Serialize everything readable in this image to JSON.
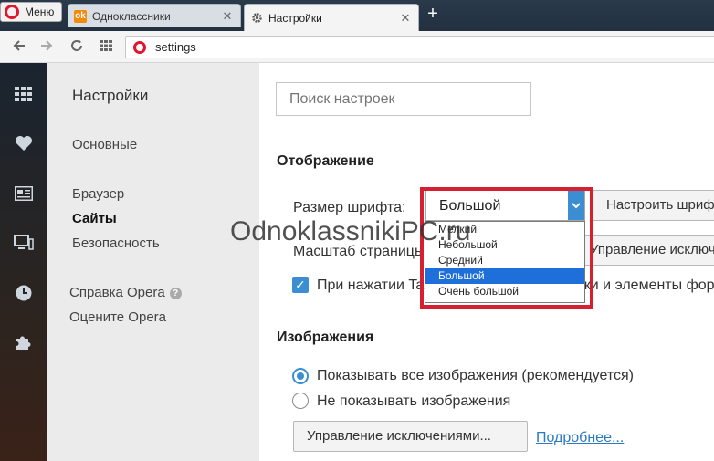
{
  "browser": {
    "menu_label": "Меню",
    "tabs": [
      {
        "title": "Одноклассники",
        "icon": "odnoklassniki-icon"
      },
      {
        "title": "Настройки",
        "icon": "gear-icon"
      }
    ],
    "new_tab_symbol": "+",
    "close_symbol": "✕",
    "address": "settings"
  },
  "nav": {
    "title": "Настройки",
    "items": [
      "Основные",
      "Браузер",
      "Сайты",
      "Безопасность"
    ],
    "active_item": "Сайты",
    "help_link": "Справка Opera",
    "rate_link": "Оцените Opera",
    "help_icon_glyph": "?"
  },
  "main": {
    "search_placeholder": "Поиск настроек",
    "display": {
      "title": "Отображение",
      "font_size_label": "Размер шрифта:",
      "font_size_value": "Большой",
      "customize_fonts_btn": "Настроить шрифты...",
      "zoom_label": "Масштаб страницы:",
      "manage_exceptions_btn": "Управление исключениями...",
      "tab_cycle_label": "При нажатии Tab выделяются все ссылки и элементы форм",
      "tab_cycle_checked": true,
      "font_options": [
        "Мелкий",
        "Небольшой",
        "Средний",
        "Большой",
        "Очень большой"
      ],
      "font_option_selected": "Большой"
    },
    "images": {
      "title": "Изображения",
      "show_all": "Показывать все изображения (рекомендуется)",
      "dont_show": "Не показывать изображения",
      "selected": "show_all",
      "manage_exceptions_btn": "Управление исключениями...",
      "learn_more": "Подробнее..."
    }
  },
  "watermark": "OdnoklassnikiPC.ru",
  "colors": {
    "accent": "#3c8ed3",
    "highlight_frame": "#d42030",
    "opera_red": "#e0182e",
    "dropdown_selected": "#1e6fd9"
  }
}
